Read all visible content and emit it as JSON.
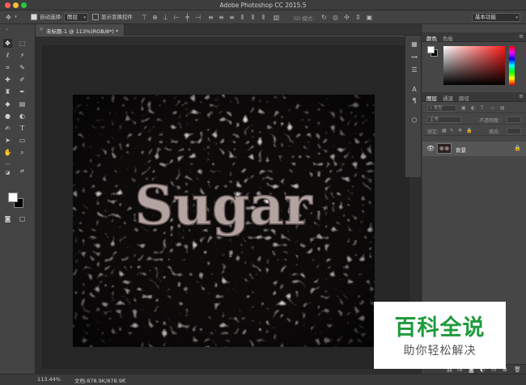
{
  "window": {
    "title": "Adobe Photoshop CC 2015.5"
  },
  "options_bar": {
    "auto_select_label": "自动选择:",
    "auto_select_checked": true,
    "auto_select_value": "图层",
    "show_transform_label": "显示变换控件",
    "show_transform_checked": false,
    "mode_3d_label": "3D 模式:",
    "workspace_value": "基本功能"
  },
  "document": {
    "tab_label": "未标题-1 @ 113%(RGB/8*) *"
  },
  "status": {
    "zoom": "113.44%",
    "doc_size": "文档:878.9K/878.9K"
  },
  "color_panel": {
    "tabs": [
      "颜色",
      "色板"
    ],
    "foreground": "#ffffff",
    "background": "#000000"
  },
  "layers_panel": {
    "tabs": [
      "图层",
      "通道",
      "路径"
    ],
    "filter_kind": "类型",
    "blend_mode": "正常",
    "opacity_label": "不透明度:",
    "lock_label": "锁定:",
    "fill_label": "填充:",
    "layers": [
      {
        "name": "背景",
        "visible": true,
        "locked": true
      }
    ]
  },
  "canvas": {
    "pattern": "cellular-mesh",
    "text": "Sugar",
    "colors": {
      "mesh": "#c9bdb9",
      "cell": "#0d0a0a",
      "text": "#b3a3a1"
    }
  },
  "watermark": {
    "main_text": "百科全说",
    "sub_text": "助你轻松解决",
    "color": "#1f9a3c"
  },
  "icons": {
    "tools": [
      "move-icon",
      "marquee-icon",
      "lasso-icon",
      "magic-wand-icon",
      "crop-icon",
      "eyedropper-icon",
      "healing-brush-icon",
      "brush-icon",
      "clone-stamp-icon",
      "history-brush-icon",
      "eraser-icon",
      "gradient-icon",
      "blur-icon",
      "dodge-icon",
      "pen-icon",
      "type-icon",
      "path-selection-icon",
      "rectangle-icon",
      "hand-icon",
      "zoom-icon",
      "more-tools-icon"
    ]
  }
}
